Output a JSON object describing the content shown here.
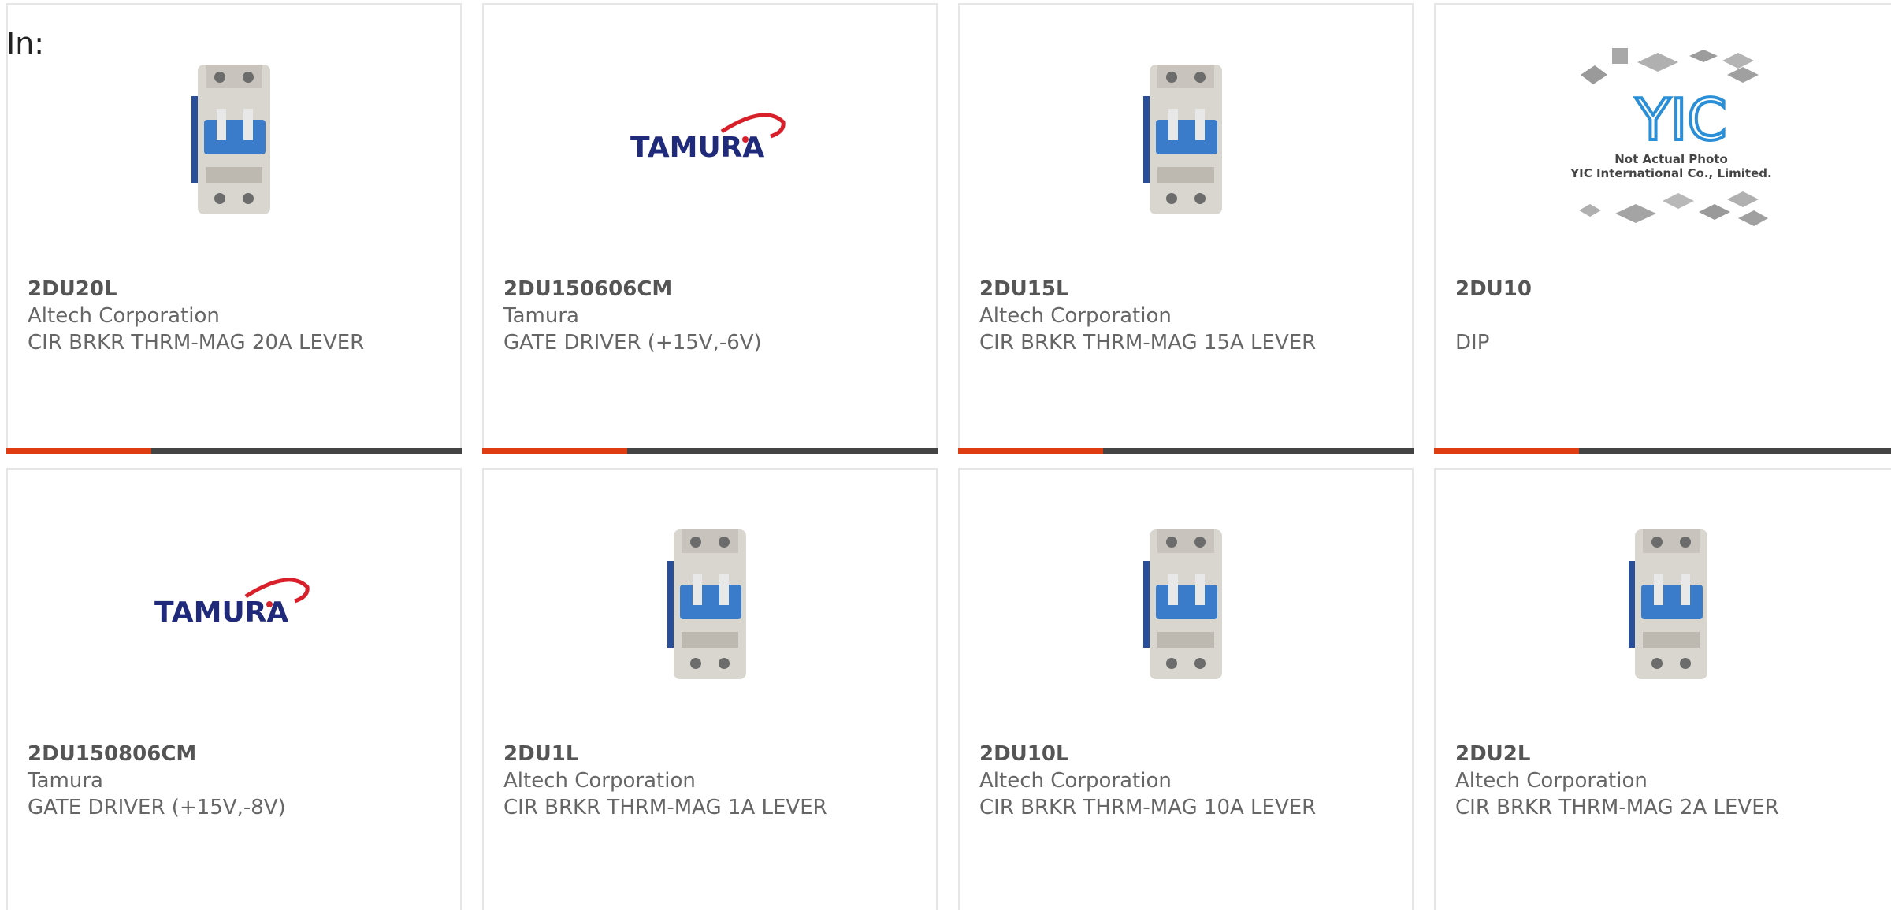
{
  "header": {
    "in_label": "In:"
  },
  "colors": {
    "accent_red": "#e03c12",
    "accent_dark": "#444444",
    "tamura_blue": "#1f2a7a",
    "tamura_red": "#d8202b",
    "breaker_blue": "#3a7cc9",
    "yic_blue": "#2a8fd6"
  },
  "products": [
    {
      "part": "2DU20L",
      "manufacturer": "Altech Corporation",
      "description": "CIR BRKR THRM-MAG 20A LEVER",
      "image": "breaker-icon"
    },
    {
      "part": "2DU150606CM",
      "manufacturer": "Tamura",
      "description": "GATE DRIVER (+15V,-6V)",
      "image": "tamura-logo",
      "logo_text": "TAMURA"
    },
    {
      "part": "2DU15L",
      "manufacturer": "Altech Corporation",
      "description": "CIR BRKR THRM-MAG 15A LEVER",
      "image": "breaker-icon"
    },
    {
      "part": "2DU10",
      "manufacturer": "",
      "description": "DIP",
      "image": "yic-placeholder",
      "logo_text": "YIC",
      "caption_line1": "Not Actual Photo",
      "caption_line2": "YIC International Co., Limited."
    },
    {
      "part": "2DU150806CM",
      "manufacturer": "Tamura",
      "description": "GATE DRIVER (+15V,-8V)",
      "image": "tamura-logo",
      "logo_text": "TAMURA"
    },
    {
      "part": "2DU1L",
      "manufacturer": "Altech Corporation",
      "description": "CIR BRKR THRM-MAG 1A LEVER",
      "image": "breaker-icon"
    },
    {
      "part": "2DU10L",
      "manufacturer": "Altech Corporation",
      "description": "CIR BRKR THRM-MAG 10A LEVER",
      "image": "breaker-icon"
    },
    {
      "part": "2DU2L",
      "manufacturer": "Altech Corporation",
      "description": "CIR BRKR THRM-MAG 2A LEVER",
      "image": "breaker-icon"
    }
  ]
}
